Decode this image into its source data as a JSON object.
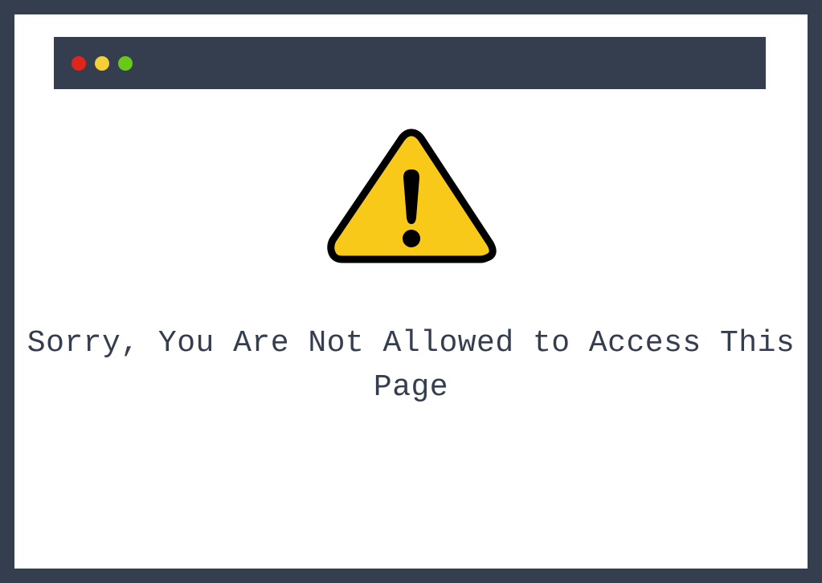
{
  "titlebar": {
    "buttons": {
      "close": "close",
      "minimize": "minimize",
      "maximize": "maximize"
    }
  },
  "content": {
    "message": "Sorry, You Are Not Allowed to Access This Page"
  },
  "colors": {
    "frame": "#343e4e",
    "red": "#e1251b",
    "yellow": "#f5cf3a",
    "green": "#66ca16",
    "warning": "#f9c919"
  }
}
